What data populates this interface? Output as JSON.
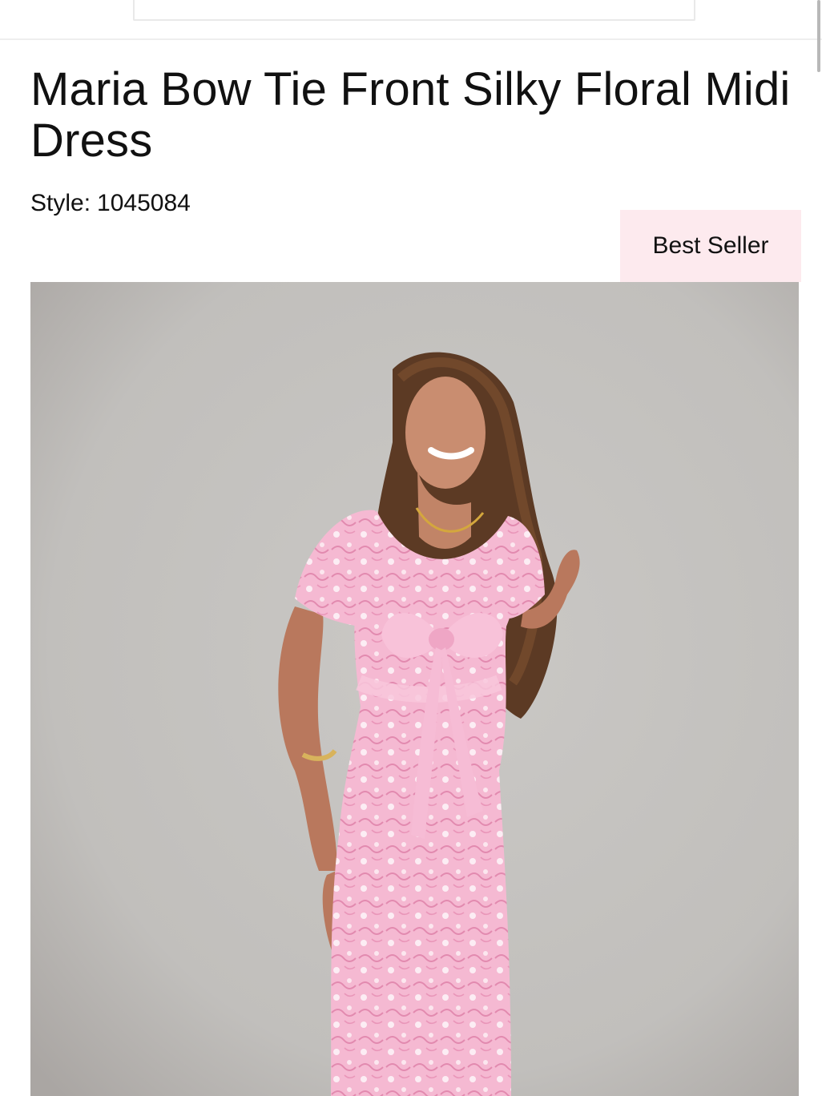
{
  "product": {
    "title": "Maria Bow Tie Front Silky Floral Midi Dress",
    "style_label": "Style:",
    "style_number": "1045084",
    "badge": "Best Seller",
    "image_alt": "Model wearing pink floral midi dress with bow tie front"
  },
  "colors": {
    "badge_background": "#fdeaee",
    "dress_pink": "#f4b4cf",
    "image_background": "#c4c2bf"
  }
}
